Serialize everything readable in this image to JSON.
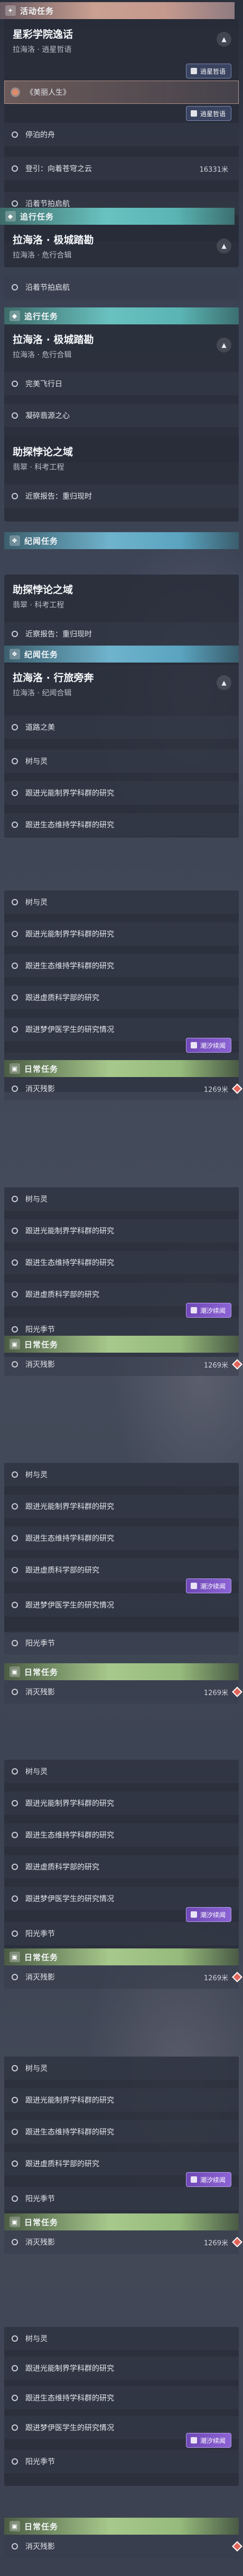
{
  "sections": {
    "event": {
      "label": "活动任务",
      "icon": "star-icon"
    },
    "follow": {
      "label": "追行任务",
      "icon": "map-icon"
    },
    "legend": {
      "label": "纪闻任务",
      "icon": "book-icon"
    },
    "daily": {
      "label": "日常任务",
      "icon": "calendar-icon"
    }
  },
  "quests": {
    "starry": {
      "title": "星彩学院逸话",
      "subtitle": "拉海洛 · 逍星哲语"
    },
    "lahai_a": {
      "title": "拉海洛 · 极城踏勘",
      "subtitle": "拉海洛 · 危行合辑"
    },
    "lahai_b": {
      "title": "拉海洛 · 极城踏勘",
      "subtitle": "拉海洛 · 危行合辑"
    },
    "zhuzhen1": {
      "title": "助探悖论之域",
      "subtitle": "翡翠 · 科考工程"
    },
    "zhuzhen2": {
      "title": "助探悖论之域",
      "subtitle": "翡翠 · 科考工程"
    },
    "lahai_c": {
      "title": "拉海洛 · 行旅旁奔",
      "subtitle": "拉海洛 · 纪闻合辑"
    }
  },
  "items": {
    "beauty": "《美丽人生》",
    "ship": "停泊的舟",
    "heaven": "登引：向着苍穹之云",
    "distance_1": "16331米",
    "trace": "沿着节拍启航",
    "trace2": "沿着节拍启航",
    "flying": "完美飞行日",
    "heart": "凝碎翡源之心",
    "revisit1": "近察报告：重归现时",
    "revisit2": "近察报告：重归现时",
    "xiaoyu": "道路之美",
    "shuyu": "树与灵",
    "guangcheng": "跟进光能制界学科群的研究",
    "shengtai": "跟进生态维持学科群的研究",
    "wuzhi": "跟进虚质科学部的研究",
    "mengbo": "跟进梦伊医学生的研究情况",
    "yangguang": "阳光季节",
    "xiaoxiao": "消灭残影",
    "distance_d": "1269米"
  },
  "tags": {
    "chase": "逍星哲语",
    "fazhi": "潮汐续闻"
  },
  "colors": {
    "event": "#c9a091",
    "follow": "#69c2c0",
    "legend": "#6fb3cc",
    "daily": "#a7c98c",
    "purple": "#8c63d4",
    "warn": "#e0645a"
  }
}
